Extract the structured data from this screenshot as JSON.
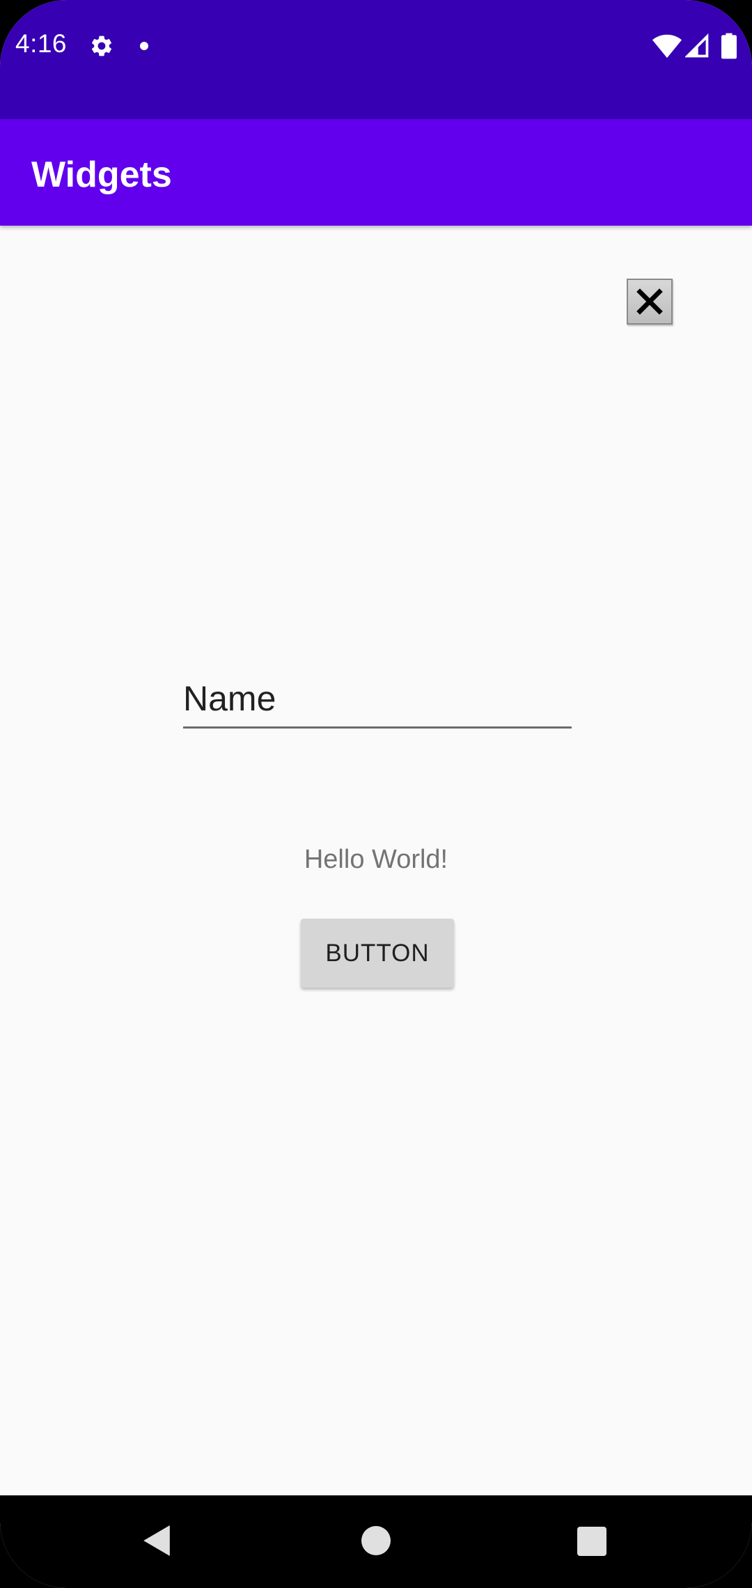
{
  "status_bar": {
    "time": "4:16",
    "icons": [
      "gear-icon",
      "notification-dot",
      "wifi-icon",
      "signal-icon",
      "battery-icon"
    ],
    "color": "#3700b3"
  },
  "app_bar": {
    "title": "Widgets",
    "color": "#6200ee"
  },
  "close_button": {
    "icon": "close-icon"
  },
  "name_field": {
    "value": "Name"
  },
  "hello_text": "Hello World!",
  "button": {
    "label": "BUTTON"
  },
  "nav_bar": {
    "icons": [
      "back-icon",
      "home-icon",
      "recents-icon"
    ]
  }
}
